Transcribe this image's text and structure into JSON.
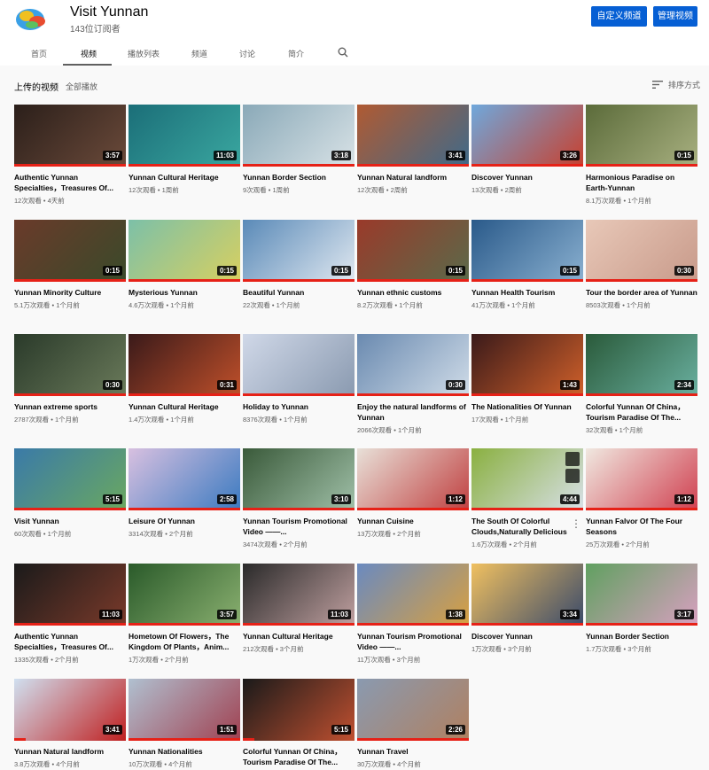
{
  "channel": {
    "name": "Visit Yunnan",
    "subscribers": "143位订阅者",
    "buttons": {
      "customize": "自定义频道",
      "manage": "管理视频"
    }
  },
  "tabs": [
    {
      "label": "首页"
    },
    {
      "label": "视频"
    },
    {
      "label": "播放列表"
    },
    {
      "label": "频道"
    },
    {
      "label": "讨论"
    },
    {
      "label": "简介"
    }
  ],
  "section": {
    "title": "上传的视频",
    "play_all": "全部播放",
    "sort": "排序方式"
  },
  "videos": [
    {
      "title": "Authentic Yunnan Specialties，Treasures Of...",
      "meta": "12次观看 • 4天前",
      "duration": "3:57"
    },
    {
      "title": "Yunnan Cultural Heritage",
      "meta": "12次观看 • 1周前",
      "duration": "11:03"
    },
    {
      "title": "Yunnan Border Section",
      "meta": "9次观看 • 1周前",
      "duration": "3:18"
    },
    {
      "title": "Yunnan Natural landform",
      "meta": "12次观看 • 2周前",
      "duration": "3:41"
    },
    {
      "title": "Discover Yunnan",
      "meta": "13次观看 • 2周前",
      "duration": "3:26"
    },
    {
      "title": "Harmonious Paradise on Earth-Yunnan",
      "meta": "8.1万次观看 • 1个月前",
      "duration": "0:15"
    },
    {
      "title": "Yunnan Minority Culture",
      "meta": "5.1万次观看 • 1个月前",
      "duration": "0:15"
    },
    {
      "title": "Mysterious Yunnan",
      "meta": "4.6万次观看 • 1个月前",
      "duration": "0:15"
    },
    {
      "title": "Beautiful Yunnan",
      "meta": "22次观看 • 1个月前",
      "duration": "0:15"
    },
    {
      "title": "Yunnan ethnic customs",
      "meta": "8.2万次观看 • 1个月前",
      "duration": "0:15"
    },
    {
      "title": "Yunnan Health Tourism",
      "meta": "41万次观看 • 1个月前",
      "duration": "0:15"
    },
    {
      "title": "Tour the border area of Yunnan",
      "meta": "8503次观看 • 1个月前",
      "duration": "0:30"
    },
    {
      "title": "Yunnan extreme sports",
      "meta": "2787次观看 • 1个月前",
      "duration": "0:30"
    },
    {
      "title": "Yunnan Cultural Heritage",
      "meta": "1.4万次观看 • 1个月前",
      "duration": "0:31"
    },
    {
      "title": "Holiday to Yunnan",
      "meta": "8376次观看 • 1个月前",
      "duration": ""
    },
    {
      "title": "Enjoy the natural landforms of Yunnan",
      "meta": "2066次观看 • 1个月前",
      "duration": "0:30"
    },
    {
      "title": "The Nationalities Of Yunnan",
      "meta": "17次观看 • 1个月前",
      "duration": "1:43"
    },
    {
      "title": "Colorful Yunnan Of China，Tourism Paradise Of The...",
      "meta": "32次观看 • 1个月前",
      "duration": "2:34"
    },
    {
      "title": "Visit Yunnan",
      "meta": "60次观看 • 1个月前",
      "duration": "5:15"
    },
    {
      "title": "Leisure Of Yunnan",
      "meta": "3314次观看 • 2个月前",
      "duration": "2:58"
    },
    {
      "title": "Yunnan Tourism Promotional Video ——...",
      "meta": "3474次观看 • 2个月前",
      "duration": "3:10"
    },
    {
      "title": "Yunnan Cuisine",
      "meta": "13万次观看 • 2个月前",
      "duration": "1:12"
    },
    {
      "title": "The South Of Colorful Clouds,Naturally Delicious",
      "meta": "1.6万次观看 • 2个月前",
      "duration": "4:44"
    },
    {
      "title": "Yunnan Falvor Of The Four Seasons",
      "meta": "25万次观看 • 2个月前",
      "duration": "1:12"
    },
    {
      "title": "Authentic Yunnan Specialties，Treasures Of...",
      "meta": "1335次观看 • 2个月前",
      "duration": "11:03"
    },
    {
      "title": "Hometown Of Flowers，The Kingdom Of Plants，Anim...",
      "meta": "1万次观看 • 2个月前",
      "duration": "3:57"
    },
    {
      "title": "Yunnan Cultural Heritage",
      "meta": "212次观看 • 3个月前",
      "duration": "11:03"
    },
    {
      "title": "Yunnan Tourism Promotional Video ——...",
      "meta": "11万次观看 • 3个月前",
      "duration": "1:38"
    },
    {
      "title": "Discover Yunnan",
      "meta": "1万次观看 • 3个月前",
      "duration": "3:34"
    },
    {
      "title": "Yunnan Border Section",
      "meta": "1.7万次观看 • 3个月前",
      "duration": "3:17"
    },
    {
      "title": "Yunnan Natural landform",
      "meta": "3.8万次观看 • 4个月前",
      "duration": "3:41"
    },
    {
      "title": "Yunnan Nationalities",
      "meta": "10万次观看 • 4个月前",
      "duration": "1:51"
    },
    {
      "title": "Colorful Yunnan Of China，Tourism Paradise Of The...",
      "meta": "2.2万次观看 • 4个月前",
      "duration": "5:15"
    },
    {
      "title": "Yunnan Travel",
      "meta": "30万次观看 • 4个月前",
      "duration": "2:26"
    }
  ],
  "colors": {
    "accent": "#065fd4",
    "progress": "#e62117"
  }
}
